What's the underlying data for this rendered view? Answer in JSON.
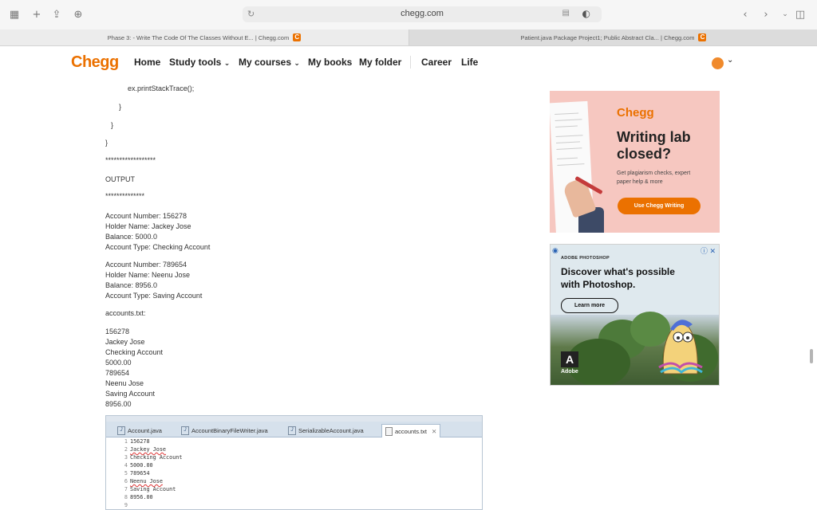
{
  "browser": {
    "url": "chegg.com",
    "tabs": [
      {
        "title": "Phase 3: - Write The Code Of The Classes Without E... | Chegg.com"
      },
      {
        "title": "Patient.java Package Project1; Public Abstract Cla... | Chegg.com"
      }
    ]
  },
  "nav": {
    "logo": "Chegg",
    "items": [
      "Home",
      "Study tools",
      "My courses",
      "My books",
      "My folder",
      "Career",
      "Life"
    ]
  },
  "code": {
    "line1": "ex.printStackTrace();",
    "close1": "}",
    "close2": "}",
    "close3": "}"
  },
  "content": {
    "stars1": "******************",
    "output_label": "OUTPUT",
    "stars2": "**************",
    "account1": [
      "Account Number: 156278",
      "Holder Name: Jackey Jose",
      "Balance: 5000.0",
      "Account Type: Checking Account"
    ],
    "account2": [
      "Account Number: 789654",
      "Holder Name: Neenu Jose",
      "Balance: 8956.0",
      "Account Type: Saving Account"
    ],
    "file_label": "accounts.txt:",
    "file_lines": [
      "156278",
      "Jackey Jose",
      "Checking Account",
      "5000.00",
      "789654",
      "Neenu Jose",
      "Saving Account",
      "8956.00"
    ]
  },
  "ad1": {
    "brand": "Chegg",
    "headline": "Writing lab closed?",
    "sub": "Get plagiarism checks, expert paper help & more",
    "button": "Use Chegg Writing"
  },
  "ad2": {
    "tag": "ADOBE PHOTOSHOP",
    "headline": "Discover what's possible with Photoshop.",
    "button": "Learn more",
    "brand": "Adobe"
  },
  "ide": {
    "tabs": [
      "Account.java",
      "AccountBinaryFileWriter.java",
      "SerializableAccount.java",
      "accounts.txt"
    ],
    "lines": [
      {
        "n": "1",
        "t": "156278"
      },
      {
        "n": "2",
        "t": "Jackey Jose"
      },
      {
        "n": "3",
        "t": "Checking Account"
      },
      {
        "n": "4",
        "t": "5000.00"
      },
      {
        "n": "5",
        "t": "789654"
      },
      {
        "n": "6",
        "t": "Neenu Jose"
      },
      {
        "n": "7",
        "t": "Saving Account"
      },
      {
        "n": "8",
        "t": "8956.00"
      },
      {
        "n": "9",
        "t": ""
      }
    ]
  },
  "colors": {
    "accent": "#eb7100",
    "ad1_bg": "#f6c7c0"
  }
}
